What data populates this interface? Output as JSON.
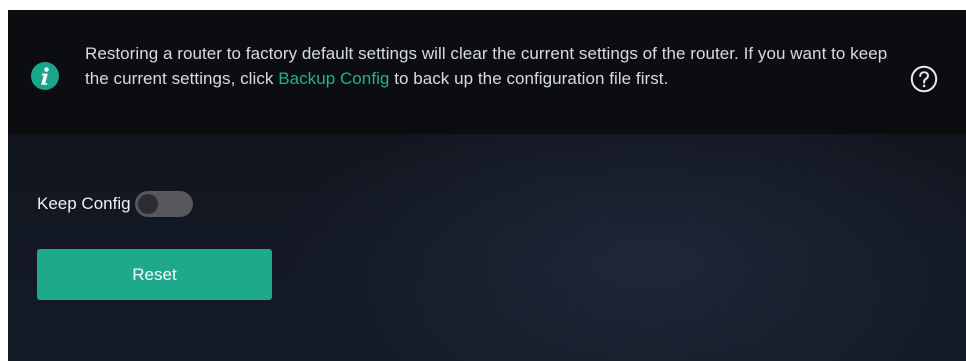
{
  "notice": {
    "icon": "info-icon",
    "text_before": "Restoring a router to factory default settings will clear the current settings of the router. If you want to keep the current settings, click ",
    "link_label": "Backup Config",
    "text_after": " to back up the configuration file first.",
    "help_icon": "help-question-icon"
  },
  "keep_config": {
    "label": "Keep Config",
    "enabled": false
  },
  "actions": {
    "reset_label": "Reset"
  },
  "colors": {
    "accent": "#1ea98b",
    "link": "#22b08f",
    "notice_background": "#0b0d11",
    "page_background": "#121722",
    "toggle_off": "#56585d"
  }
}
